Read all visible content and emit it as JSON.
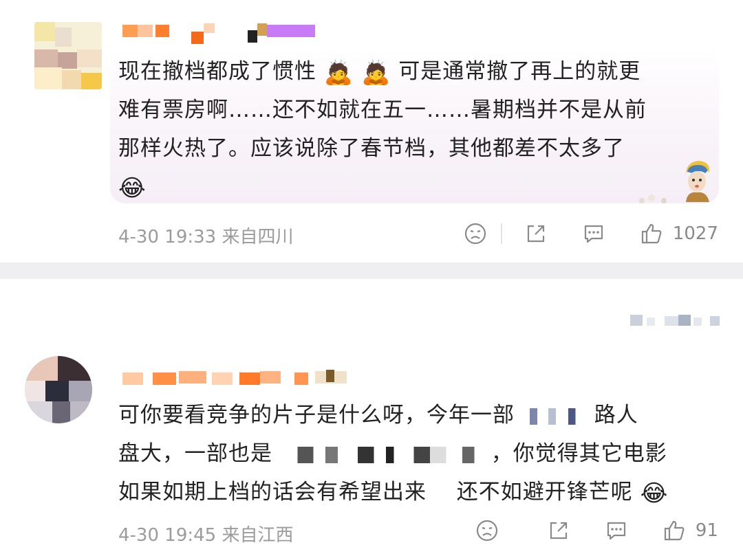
{
  "comments": [
    {
      "lines": [
        "现在撤档都成了惯性",
        "可是通常撤了再上的就更",
        "难有票房啊……还不如就在五一……暑期档并不是从前",
        "那样火热了。应该说除了春节档，其他都差不太多了"
      ],
      "emoji_inline": "🙇",
      "emoji_end": "😂",
      "time": "4-30 19:33",
      "location": "来自四川",
      "likes": "1027",
      "icons": [
        "dislike-icon",
        "share-icon",
        "comment-icon",
        "like-icon"
      ]
    },
    {
      "lines": [
        "可你要看竞争的片子是什么呀，今年一部",
        "路人",
        "盘大，一部也是",
        "，你觉得其它电影",
        "如果如期上档的话会有希望出来",
        "还不如避开锋芒呢"
      ],
      "emoji_end": "😂",
      "time": "4-30 19:45",
      "location": "来自江西",
      "likes": "91",
      "icons": [
        "dislike-icon",
        "share-icon",
        "comment-icon",
        "like-icon"
      ]
    }
  ]
}
